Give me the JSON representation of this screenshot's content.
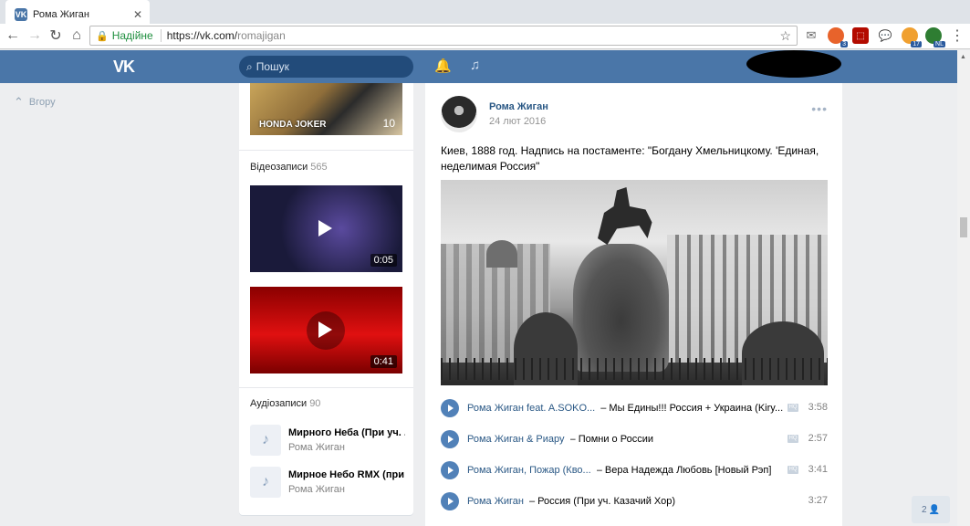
{
  "browser": {
    "tab_title": "Рома Жиган",
    "tab_favicon": "VK",
    "secure_label": "Надійне",
    "url_base": "https://vk.com/",
    "url_path": "romajigan",
    "extension_badges": [
      "3",
      "17",
      "NL"
    ]
  },
  "vk_header": {
    "logo": "VK",
    "search_placeholder": "Пошук"
  },
  "left_nav": {
    "up_label": "Вгору"
  },
  "sidebar": {
    "photo_album": {
      "title": "HONDA JOKER",
      "count": "10"
    },
    "videos": {
      "label": "Відеозаписи",
      "count": "565",
      "items": [
        {
          "duration": "0:05"
        },
        {
          "duration": "0:41"
        }
      ]
    },
    "audios": {
      "label": "Аудіозаписи",
      "count": "90",
      "items": [
        {
          "title": "Мирного Неба (При уч. ...",
          "artist": "Рома Жиган"
        },
        {
          "title": "Мирное Небо RMX (при ...",
          "artist": "Рома Жиган"
        }
      ]
    }
  },
  "post": {
    "author": "Рома Жиган",
    "date": "24 лют 2016",
    "more": "•••",
    "text": "Киев, 1888 год. Надпись на постаменте: \"Богдану Хмельницкому. 'Единая, неделимая Россия\"",
    "tracks": [
      {
        "artist": "Рома Жиган feat. A.SOKO...",
        "title": "– Мы Едины!!! Россия + Украина (Kiry...",
        "duration": "3:58",
        "hq": true
      },
      {
        "artist": "Рома Жиган & Риару",
        "title": "– Помни о России",
        "duration": "2:57",
        "hq": true
      },
      {
        "artist": "Рома Жиган, Пожар (Кво...",
        "title": "– Вера Надежда Любовь [Новый Рэп]",
        "duration": "3:41",
        "hq": true
      },
      {
        "artist": "Рома Жиган",
        "title": "– Россия (При уч. Казачий Хор)",
        "duration": "3:27",
        "hq": false
      }
    ]
  },
  "friends_button": {
    "count": "2"
  },
  "colors": {
    "vk_blue": "#4a76a8",
    "link": "#2a5885",
    "page_bg": "#edeef0"
  }
}
